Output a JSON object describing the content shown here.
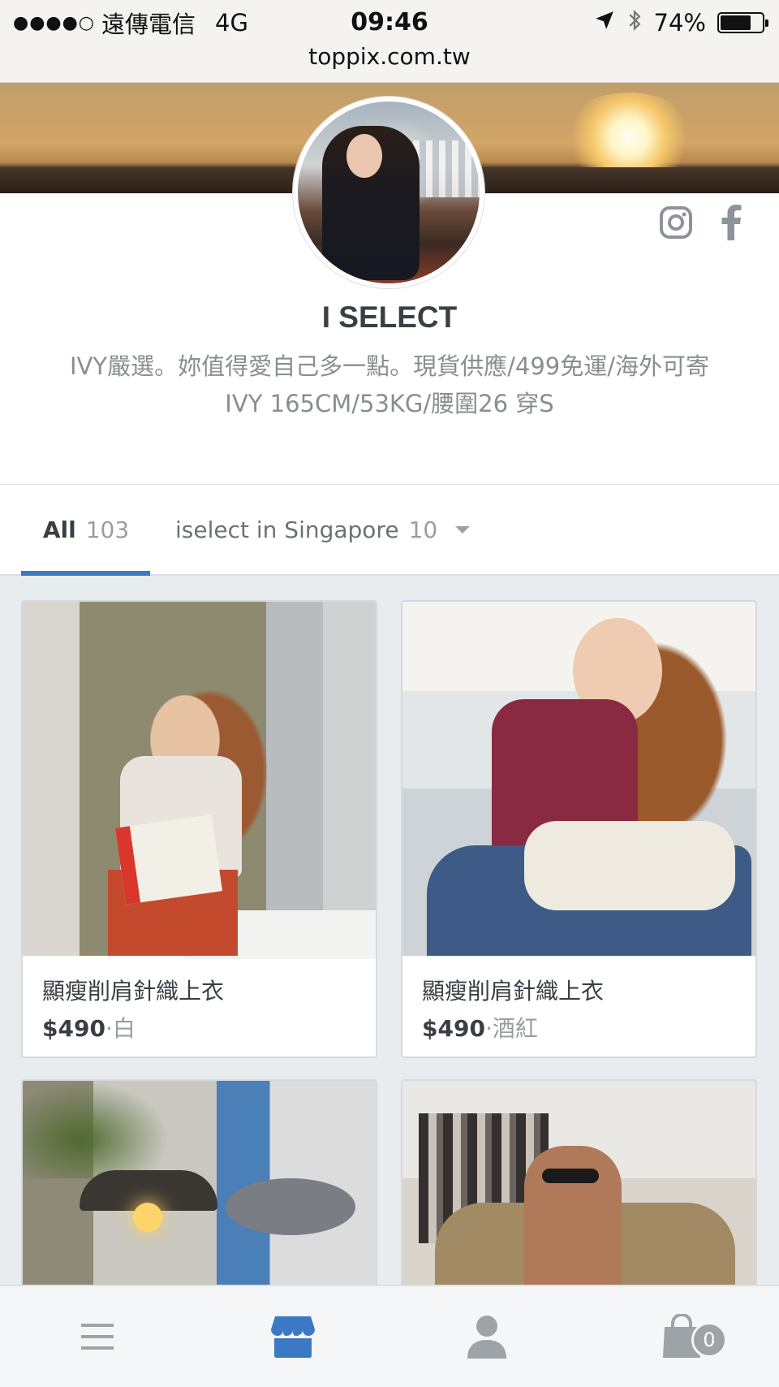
{
  "status_bar": {
    "signal": "●●●●○",
    "carrier": "遠傳電信",
    "network": "4G",
    "time": "09:46",
    "battery": "74%",
    "battery_level": 0.74
  },
  "browser": {
    "url": "toppix.com.tw"
  },
  "profile": {
    "name": "I SELECT",
    "bio_line1": "IVY嚴選。妳值得愛自己多一點。現貨供應/499免運/海外可寄",
    "bio_line2": "IVY 165CM/53KG/腰圍26 穿S"
  },
  "tabs": [
    {
      "label": "All",
      "count": "103",
      "active": true
    },
    {
      "label": "iselect in Singapore",
      "count": "10",
      "active": false
    }
  ],
  "products": [
    {
      "title": "顯瘦削肩針織上衣",
      "price": "$490",
      "variant": "·白"
    },
    {
      "title": "顯瘦削肩針織上衣",
      "price": "$490",
      "variant": "·酒紅"
    }
  ],
  "cart": {
    "count": "0"
  },
  "colors": {
    "accent": "#3c79c5",
    "text_dark": "#3a3e45",
    "text_muted": "#8a8d92",
    "icon_gray": "#9ea3a8"
  },
  "icons": {
    "status": [
      "location-arrow-icon",
      "bluetooth-icon",
      "battery-icon"
    ],
    "social": [
      "instagram-icon",
      "facebook-icon"
    ],
    "bottom_nav": [
      "menu-icon",
      "store-icon",
      "user-icon",
      "shopping-bag-icon"
    ]
  }
}
